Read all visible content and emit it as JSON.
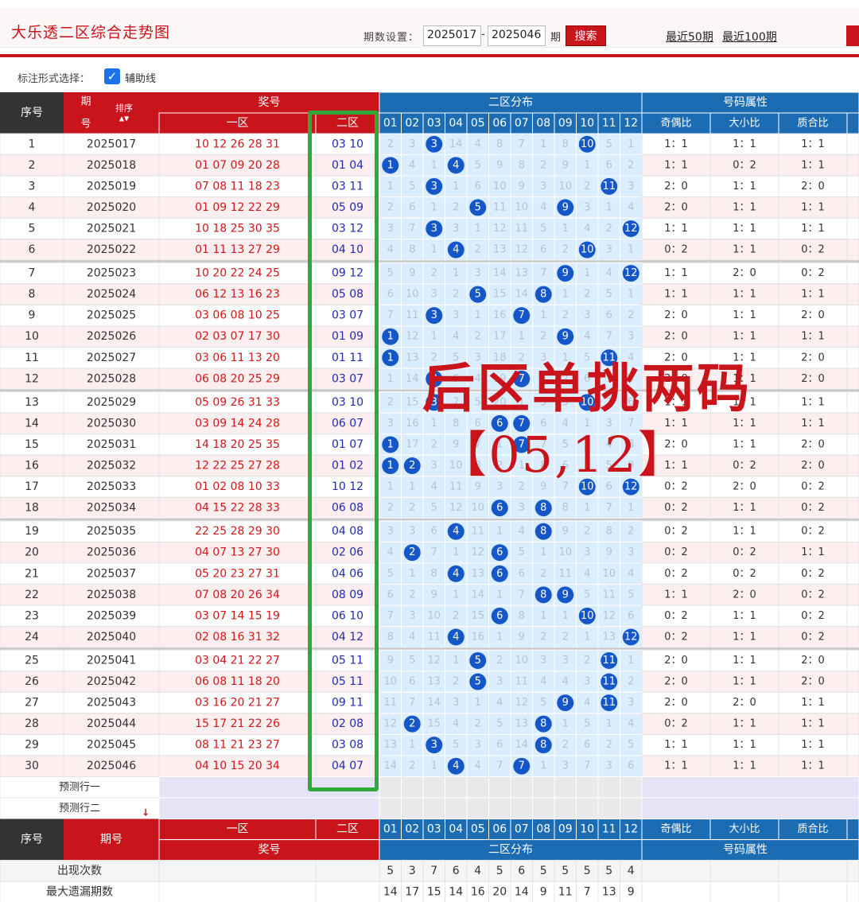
{
  "header": {
    "title": "大乐透二区综合走势图",
    "period_label": "期数设置：",
    "period_from": "2025017",
    "period_to": "2025046",
    "period_unit": "期",
    "search_label": "搜索",
    "link_50": "最近50期",
    "link_100": "最近100期"
  },
  "options": {
    "label": "标注形式选择：",
    "aux_line_label": "辅助线",
    "aux_line_checked": true
  },
  "table": {
    "h_seq": "序号",
    "h_period1": "期",
    "h_period2": "号",
    "h_sort": "排序",
    "h_prize": "奖号",
    "h_zone1": "一区",
    "h_zone2": "二区",
    "h_dist": "二区分布",
    "h_attr": "号码属性",
    "attr_headers": [
      "奇偶比",
      "大小比",
      "质合比"
    ],
    "nums": [
      "01",
      "02",
      "03",
      "04",
      "05",
      "06",
      "07",
      "08",
      "09",
      "10",
      "11",
      "12"
    ],
    "rows": [
      {
        "seq": "1",
        "period": "2025017",
        "zone1": "10 12 26 28 31",
        "zone2": "03 10",
        "dist": [
          "2",
          "3",
          "3",
          "14",
          "4",
          "8",
          "7",
          "1",
          "8",
          "10",
          "5",
          "1"
        ],
        "hits": [
          2,
          9
        ],
        "attr": [
          "1：1",
          "1：1",
          "1：1"
        ]
      },
      {
        "seq": "2",
        "period": "2025018",
        "zone1": "01 07 09 20 28",
        "zone2": "01 04",
        "dist": [
          "1",
          "4",
          "1",
          "4",
          "5",
          "9",
          "8",
          "2",
          "9",
          "1",
          "6",
          "2"
        ],
        "hits": [
          0,
          3
        ],
        "attr": [
          "1：1",
          "0：2",
          "1：1"
        ]
      },
      {
        "seq": "3",
        "period": "2025019",
        "zone1": "07 08 11 18 23",
        "zone2": "03 11",
        "dist": [
          "1",
          "5",
          "3",
          "1",
          "6",
          "10",
          "9",
          "3",
          "10",
          "2",
          "11",
          "3"
        ],
        "hits": [
          2,
          10
        ],
        "attr": [
          "2：0",
          "1：1",
          "2：0"
        ]
      },
      {
        "seq": "4",
        "period": "2025020",
        "zone1": "01 09 12 22 29",
        "zone2": "05 09",
        "dist": [
          "2",
          "6",
          "1",
          "2",
          "5",
          "11",
          "10",
          "4",
          "9",
          "3",
          "1",
          "4"
        ],
        "hits": [
          4,
          8
        ],
        "attr": [
          "2：0",
          "1：1",
          "1：1"
        ]
      },
      {
        "seq": "5",
        "period": "2025021",
        "zone1": "10 18 25 30 35",
        "zone2": "03 12",
        "dist": [
          "3",
          "7",
          "3",
          "3",
          "1",
          "12",
          "11",
          "5",
          "1",
          "4",
          "2",
          "12"
        ],
        "hits": [
          2,
          11
        ],
        "attr": [
          "1：1",
          "1：1",
          "1：1"
        ]
      },
      {
        "seq": "6",
        "period": "2025022",
        "zone1": "01 11 13 27 29",
        "zone2": "04 10",
        "dist": [
          "4",
          "8",
          "1",
          "4",
          "2",
          "13",
          "12",
          "6",
          "2",
          "10",
          "3",
          "1"
        ],
        "hits": [
          3,
          9
        ],
        "attr": [
          "0：2",
          "1：1",
          "0：2"
        ]
      },
      {
        "seq": "7",
        "period": "2025023",
        "zone1": "10 20 22 24 25",
        "zone2": "09 12",
        "dist": [
          "5",
          "9",
          "2",
          "1",
          "3",
          "14",
          "13",
          "7",
          "9",
          "1",
          "4",
          "12"
        ],
        "hits": [
          8,
          11
        ],
        "attr": [
          "1：1",
          "2：0",
          "0：2"
        ]
      },
      {
        "seq": "8",
        "period": "2025024",
        "zone1": "06 12 13 16 23",
        "zone2": "05 08",
        "dist": [
          "6",
          "10",
          "3",
          "2",
          "5",
          "15",
          "14",
          "8",
          "1",
          "2",
          "5",
          "1"
        ],
        "hits": [
          4,
          7
        ],
        "attr": [
          "1：1",
          "1：1",
          "1：1"
        ]
      },
      {
        "seq": "9",
        "period": "2025025",
        "zone1": "03 06 08 10 25",
        "zone2": "03 07",
        "dist": [
          "7",
          "11",
          "3",
          "3",
          "1",
          "16",
          "7",
          "1",
          "2",
          "3",
          "6",
          "2"
        ],
        "hits": [
          2,
          6
        ],
        "attr": [
          "2：0",
          "1：1",
          "2：0"
        ]
      },
      {
        "seq": "10",
        "period": "2025026",
        "zone1": "02 03 07 17 30",
        "zone2": "01 09",
        "dist": [
          "1",
          "12",
          "1",
          "4",
          "2",
          "17",
          "1",
          "2",
          "9",
          "4",
          "7",
          "3"
        ],
        "hits": [
          0,
          8
        ],
        "attr": [
          "2：0",
          "1：1",
          "1：1"
        ]
      },
      {
        "seq": "11",
        "period": "2025027",
        "zone1": "03 06 11 13 20",
        "zone2": "01 11",
        "dist": [
          "1",
          "13",
          "2",
          "5",
          "3",
          "18",
          "2",
          "3",
          "1",
          "5",
          "11",
          "4"
        ],
        "hits": [
          0,
          10
        ],
        "attr": [
          "2：0",
          "1：1",
          "2：0"
        ]
      },
      {
        "seq": "12",
        "period": "2025028",
        "zone1": "06 08 20 25 29",
        "zone2": "03 07",
        "dist": [
          "1",
          "14",
          "3",
          "6",
          "4",
          "19",
          "7",
          "4",
          "2",
          "6",
          "1",
          "5"
        ],
        "hits": [
          2,
          6
        ],
        "attr": [
          "2：0",
          "1：1",
          "2：0"
        ]
      },
      {
        "seq": "13",
        "period": "2025029",
        "zone1": "05 09 26 31 33",
        "zone2": "03 10",
        "dist": [
          "2",
          "15",
          "3",
          "7",
          "5",
          "20",
          "1",
          "5",
          "3",
          "10",
          "2",
          "6"
        ],
        "hits": [
          2,
          9
        ],
        "attr": [
          "1：1",
          "1：1",
          "1：1"
        ]
      },
      {
        "seq": "14",
        "period": "2025030",
        "zone1": "03 09 14 24 28",
        "zone2": "06 07",
        "dist": [
          "3",
          "16",
          "1",
          "8",
          "6",
          "6",
          "7",
          "6",
          "4",
          "1",
          "3",
          "7"
        ],
        "hits": [
          5,
          6
        ],
        "attr": [
          "1：1",
          "1：1",
          "1：1"
        ]
      },
      {
        "seq": "15",
        "period": "2025031",
        "zone1": "14 18 20 25 35",
        "zone2": "01 07",
        "dist": [
          "1",
          "17",
          "2",
          "9",
          "7",
          "1",
          "7",
          "7",
          "5",
          "2",
          "4",
          "8"
        ],
        "hits": [
          0,
          6
        ],
        "attr": [
          "2：0",
          "1：1",
          "2：0"
        ]
      },
      {
        "seq": "16",
        "period": "2025032",
        "zone1": "12 22 25 27 28",
        "zone2": "01 02",
        "dist": [
          "1",
          "2",
          "3",
          "10",
          "8",
          "2",
          "1",
          "8",
          "6",
          "3",
          "5",
          "9"
        ],
        "hits": [
          0,
          1
        ],
        "attr": [
          "1：1",
          "0：2",
          "2：0"
        ]
      },
      {
        "seq": "17",
        "period": "2025033",
        "zone1": "01 02 08 10 33",
        "zone2": "10 12",
        "dist": [
          "1",
          "1",
          "4",
          "11",
          "9",
          "3",
          "2",
          "9",
          "7",
          "10",
          "6",
          "12"
        ],
        "hits": [
          9,
          11
        ],
        "attr": [
          "0：2",
          "2：0",
          "0：2"
        ]
      },
      {
        "seq": "18",
        "period": "2025034",
        "zone1": "04 15 22 28 33",
        "zone2": "06 08",
        "dist": [
          "2",
          "2",
          "5",
          "12",
          "10",
          "6",
          "3",
          "8",
          "8",
          "1",
          "7",
          "1"
        ],
        "hits": [
          5,
          7
        ],
        "attr": [
          "0：2",
          "1：1",
          "0：2"
        ]
      },
      {
        "seq": "19",
        "period": "2025035",
        "zone1": "22 25 28 29 30",
        "zone2": "04 08",
        "dist": [
          "3",
          "3",
          "6",
          "4",
          "11",
          "1",
          "4",
          "8",
          "9",
          "2",
          "8",
          "2"
        ],
        "hits": [
          3,
          7
        ],
        "attr": [
          "0：2",
          "1：1",
          "0：2"
        ]
      },
      {
        "seq": "20",
        "period": "2025036",
        "zone1": "04 07 13 27 30",
        "zone2": "02 06",
        "dist": [
          "4",
          "2",
          "7",
          "1",
          "12",
          "6",
          "5",
          "1",
          "10",
          "3",
          "9",
          "3"
        ],
        "hits": [
          1,
          5
        ],
        "attr": [
          "0：2",
          "0：2",
          "1：1"
        ]
      },
      {
        "seq": "21",
        "period": "2025037",
        "zone1": "05 20 23 27 31",
        "zone2": "04 06",
        "dist": [
          "5",
          "1",
          "8",
          "4",
          "13",
          "6",
          "6",
          "2",
          "11",
          "4",
          "10",
          "4"
        ],
        "hits": [
          3,
          5
        ],
        "attr": [
          "0：2",
          "0：2",
          "0：2"
        ]
      },
      {
        "seq": "22",
        "period": "2025038",
        "zone1": "07 08 20 26 34",
        "zone2": "08 09",
        "dist": [
          "6",
          "2",
          "9",
          "1",
          "14",
          "1",
          "7",
          "8",
          "9",
          "5",
          "11",
          "5"
        ],
        "hits": [
          7,
          8
        ],
        "attr": [
          "1：1",
          "2：0",
          "0：2"
        ]
      },
      {
        "seq": "23",
        "period": "2025039",
        "zone1": "03 07 14 15 19",
        "zone2": "06 10",
        "dist": [
          "7",
          "3",
          "10",
          "2",
          "15",
          "6",
          "8",
          "1",
          "1",
          "10",
          "12",
          "6"
        ],
        "hits": [
          5,
          9
        ],
        "attr": [
          "0：2",
          "1：1",
          "0：2"
        ]
      },
      {
        "seq": "24",
        "period": "2025040",
        "zone1": "02 08 16 31 32",
        "zone2": "04 12",
        "dist": [
          "8",
          "4",
          "11",
          "4",
          "16",
          "1",
          "9",
          "2",
          "2",
          "1",
          "13",
          "12"
        ],
        "hits": [
          3,
          11
        ],
        "attr": [
          "0：2",
          "1：1",
          "0：2"
        ]
      },
      {
        "seq": "25",
        "period": "2025041",
        "zone1": "03 04 21 22 27",
        "zone2": "05 11",
        "dist": [
          "9",
          "5",
          "12",
          "1",
          "5",
          "2",
          "10",
          "3",
          "3",
          "2",
          "11",
          "1"
        ],
        "hits": [
          4,
          10
        ],
        "attr": [
          "2：0",
          "1：1",
          "2：0"
        ]
      },
      {
        "seq": "26",
        "period": "2025042",
        "zone1": "06 08 11 18 20",
        "zone2": "05 11",
        "dist": [
          "10",
          "6",
          "13",
          "2",
          "5",
          "3",
          "11",
          "4",
          "4",
          "3",
          "11",
          "2"
        ],
        "hits": [
          4,
          10
        ],
        "attr": [
          "2：0",
          "1：1",
          "2：0"
        ]
      },
      {
        "seq": "27",
        "period": "2025043",
        "zone1": "03 16 20 21 27",
        "zone2": "09 11",
        "dist": [
          "11",
          "7",
          "14",
          "3",
          "1",
          "4",
          "12",
          "5",
          "9",
          "4",
          "11",
          "3"
        ],
        "hits": [
          8,
          10
        ],
        "attr": [
          "2：0",
          "2：0",
          "1：1"
        ]
      },
      {
        "seq": "28",
        "period": "2025044",
        "zone1": "15 17 21 22 26",
        "zone2": "02 08",
        "dist": [
          "12",
          "2",
          "15",
          "4",
          "2",
          "5",
          "13",
          "8",
          "1",
          "5",
          "1",
          "4"
        ],
        "hits": [
          1,
          7
        ],
        "attr": [
          "0：2",
          "1：1",
          "1：1"
        ]
      },
      {
        "seq": "29",
        "period": "2025045",
        "zone1": "08 11 21 23 27",
        "zone2": "03 08",
        "dist": [
          "13",
          "1",
          "3",
          "5",
          "3",
          "6",
          "14",
          "8",
          "2",
          "6",
          "2",
          "5"
        ],
        "hits": [
          2,
          7
        ],
        "attr": [
          "1：1",
          "1：1",
          "1：1"
        ]
      },
      {
        "seq": "30",
        "period": "2025046",
        "zone1": "04 10 15 20 34",
        "zone2": "04 07",
        "dist": [
          "14",
          "2",
          "1",
          "4",
          "4",
          "7",
          "7",
          "1",
          "3",
          "7",
          "3",
          "6"
        ],
        "hits": [
          3,
          6
        ],
        "attr": [
          "1：1",
          "1：1",
          "1：1"
        ]
      }
    ],
    "predict1": "预测行一",
    "predict2": "预测行二",
    "stats_label_count": "出现次数",
    "stats_label_maxmiss": "最大遗漏期数",
    "stats_count": [
      "5",
      "3",
      "7",
      "6",
      "4",
      "5",
      "6",
      "5",
      "5",
      "5",
      "5",
      "4"
    ],
    "stats_maxmiss": [
      "14",
      "17",
      "15",
      "14",
      "16",
      "20",
      "14",
      "9",
      "11",
      "7",
      "13",
      "9"
    ]
  },
  "overlay": {
    "line1": "后区单挑两码",
    "line2": "【05,12】"
  },
  "colors": {
    "red": "#c8141a",
    "blue_header": "#1c6cb4",
    "ball": "#1557c8",
    "light_blue": "#dbeeff",
    "zone1_text": "#d01818",
    "zone2_text": "#1f2bb0",
    "green": "#2faa3a"
  }
}
